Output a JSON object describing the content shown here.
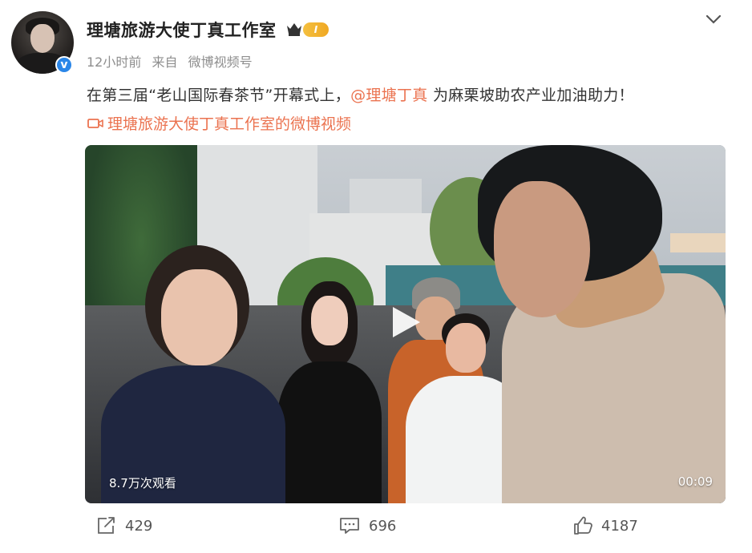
{
  "header": {
    "account_name": "理塘旅游大使丁真工作室",
    "level_badge": "I",
    "verified_mark": "v",
    "time": "12小时前",
    "source_prefix": "来自",
    "source_name": "微博视频号"
  },
  "post": {
    "text_before": "在第三届“老山国际春茶节”开幕式上，",
    "mention": "@理塘丁真",
    "text_after": " 为麻栗坡助农产业加油助力！",
    "video_link": "理塘旅游大使丁真工作室的微博视频"
  },
  "video": {
    "views": "8.7万次观看",
    "duration": "00:09"
  },
  "actions": {
    "repost_count": "429",
    "comment_count": "696",
    "like_count": "4187"
  },
  "colors": {
    "accent": "#eb7350",
    "verified": "#2a86e8",
    "muted": "#8e8e8e"
  },
  "icons": [
    "chevron-down-icon",
    "crown-icon",
    "video-camera-icon",
    "play-icon",
    "repost-icon",
    "comment-icon",
    "like-icon"
  ]
}
